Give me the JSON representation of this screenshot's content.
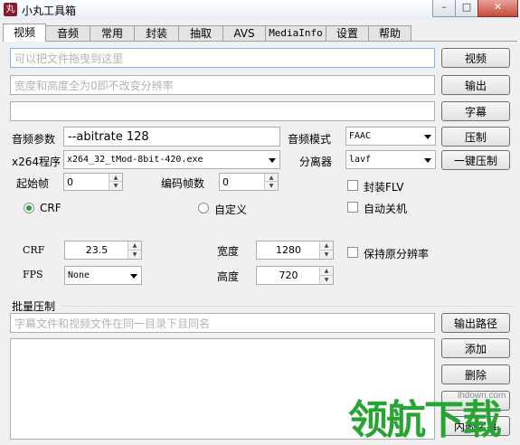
{
  "window": {
    "title": "小丸工具箱",
    "icon": "丸",
    "controls": [
      "–",
      "□",
      "✕"
    ]
  },
  "tabs": [
    "视频",
    "音频",
    "常用",
    "封装",
    "抽取",
    "AVS",
    "MediaInfo",
    "设置",
    "帮助"
  ],
  "inputs": {
    "video_file_placeholder": "可以把文件拖曳到这里",
    "resolution_placeholder": "宽度和高度全为0即不改变分辨率",
    "subtitle_value": ""
  },
  "buttons": {
    "video": "视频",
    "output": "输出",
    "subtitle": "字幕",
    "compress": "压制",
    "one_click": "一键压制",
    "output_path": "输出路径",
    "add": "添加",
    "delete": "删除",
    "hidden": "清空",
    "embed_sub": "内嵌字幕"
  },
  "audio": {
    "label": "音频参数",
    "value": "--abitrate 128",
    "mode_label": "音频模式",
    "mode_value": "FAAC"
  },
  "x264": {
    "label": "x264程序",
    "value": "x264_32_tMod-8bit-420.exe",
    "splitter_label": "分离器",
    "splitter_value": "lavf"
  },
  "frames": {
    "start_label": "起始帧",
    "start_value": "0",
    "encode_label": "编码帧数",
    "encode_value": "0"
  },
  "checkboxes": {
    "flv": "封装FLV",
    "shutdown": "自动关机",
    "keep_res": "保持原分辨率"
  },
  "radios": {
    "crf": "CRF",
    "custom": "自定义"
  },
  "params": {
    "crf_label": "CRF",
    "crf_value": "23.5",
    "fps_label": "FPS",
    "fps_value": "None",
    "width_label": "宽度",
    "width_value": "1280",
    "height_label": "高度",
    "height_value": "720"
  },
  "batch": {
    "label": "批量压制",
    "hint_placeholder": "字幕文件和视频文件在同一目录下且同名"
  },
  "watermark": {
    "text": "领航下载",
    "url": "lhdown.com"
  }
}
